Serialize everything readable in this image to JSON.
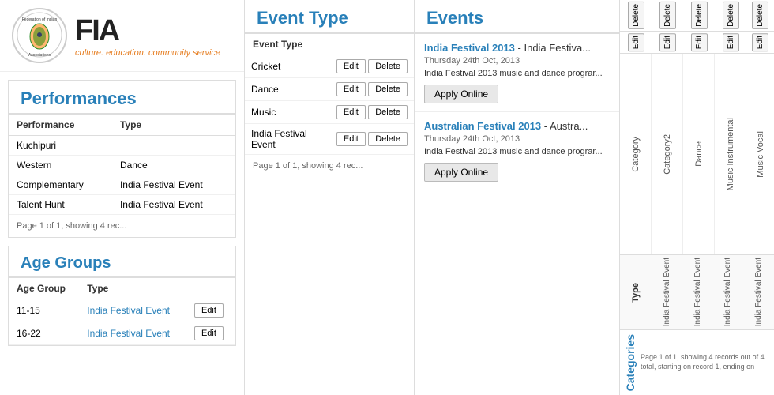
{
  "header": {
    "logo_text": "FIA",
    "tagline": "culture. education. community service",
    "org_name": "Federation of Indian Associations"
  },
  "performances": {
    "title": "Performances",
    "table_header": {
      "col1": "Performance",
      "col2": "Type"
    },
    "rows": [
      {
        "performance": "Kuchipuri",
        "type": ""
      },
      {
        "performance": "Western",
        "type": "Dance"
      },
      {
        "performance": "Complementary",
        "type": "India Festival Event"
      },
      {
        "performance": "Talent Hunt",
        "type": "India Festival Event"
      }
    ],
    "pagination": "Page 1 of 1, showing 4 rec..."
  },
  "age_groups": {
    "title": "Age Groups",
    "table_header": {
      "col1": "Age Group",
      "col2": "Type"
    },
    "rows": [
      {
        "age_group": "11-15",
        "type": "India Festival Event"
      },
      {
        "age_group": "16-22",
        "type": "India Festival Event"
      }
    ]
  },
  "event_type": {
    "title": "Event Type",
    "table_header": "Event Type",
    "rows": [
      {
        "name": "Cricket"
      },
      {
        "name": "Dance"
      },
      {
        "name": "Music"
      },
      {
        "name": "India Festival Event"
      }
    ],
    "pagination": "Page 1 of 1, showing 4 rec...",
    "buttons": {
      "edit": "Edit",
      "delete": "Delete"
    }
  },
  "events": {
    "title": "Events",
    "items": [
      {
        "title": "India Festival 2013",
        "subtitle": "- India Festiva...",
        "date": "Thursday 24th Oct, 2013",
        "desc": "India Festival 2013 music and dance prograr...",
        "button": "Apply Online"
      },
      {
        "title": "Australian Festival 2013",
        "subtitle": "- Austra...",
        "date": "Thursday 24th Oct, 2013",
        "desc": "India Festival 2013 music and dance prograr...",
        "button": "Apply Online"
      }
    ]
  },
  "right_panel": {
    "categories_label": "Categories",
    "columns": [
      {
        "header": "Category",
        "cells": [
          "Delete",
          "Edit",
          "Category"
        ]
      },
      {
        "header": "Category2",
        "cells": [
          "Delete",
          "Edit",
          "Category2"
        ]
      },
      {
        "header": "Dance",
        "cells": [
          "Delete",
          "Edit",
          "Dance"
        ]
      },
      {
        "header": "Music Instrumental",
        "cells": [
          "Delete",
          "Edit",
          "Music Instrumental"
        ]
      },
      {
        "header": "Music Vocal",
        "cells": [
          "Delete",
          "Edit",
          "Music Vocal"
        ]
      }
    ],
    "pagination": "Page 1 of 1, showing 4 records out of 4 total, starting on record 1, ending on"
  }
}
